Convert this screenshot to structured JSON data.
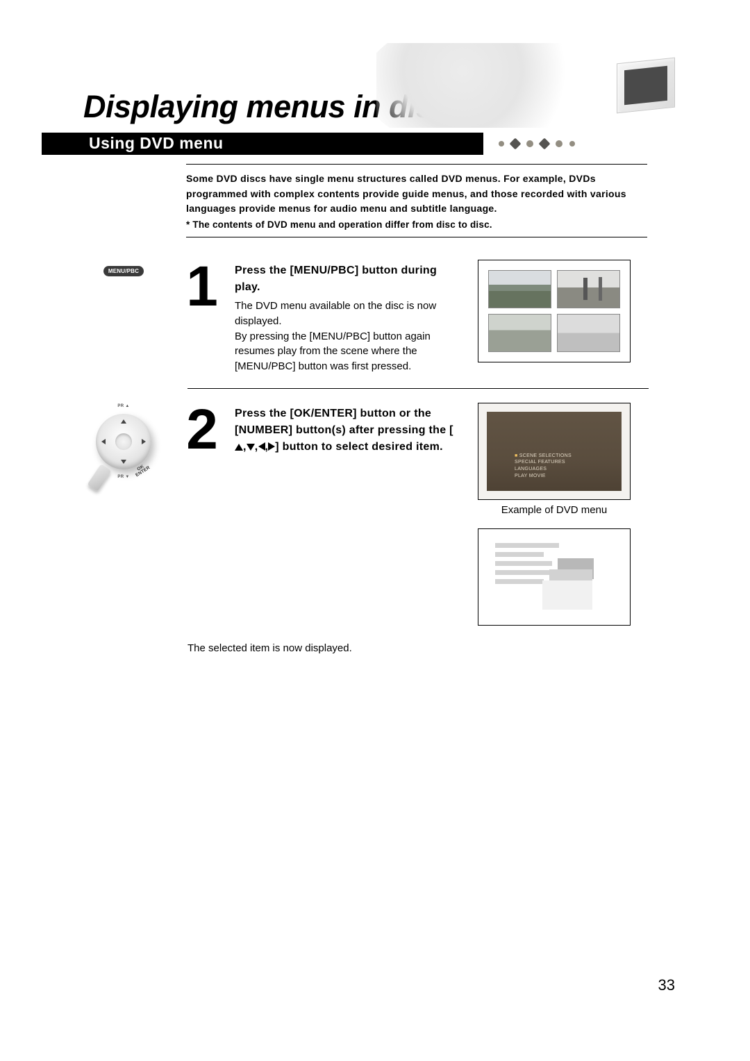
{
  "page": {
    "title": "Displaying menus in disc",
    "section_title": "Using DVD menu",
    "intro": "Some DVD discs have single menu structures called DVD menus. For example, DVDs programmed with  complex contents provide guide menus, and those recorded with various languages provide menus for audio menu and subtitle language.",
    "intro_note": "* The contents of DVD menu and operation differ from disc to disc.",
    "page_number": "33"
  },
  "icons": {
    "menu_pbc_label": "MENU/PBC",
    "pad_top": "PR ▲",
    "pad_bottom": "PR ▼",
    "pad_ok": "OK",
    "pad_enter": "ENTER"
  },
  "steps": {
    "s1": {
      "number": "1",
      "heading": "Press the [MENU/PBC] button during play.",
      "desc": "The DVD menu available on the disc is now displayed.\nBy pressing the [MENU/PBC] button again resumes play from the scene where the [MENU/PBC] button was first pressed."
    },
    "s2": {
      "number": "2",
      "heading_pre": "Press the [OK/ENTER] button or the [NUMBER] button(s) after pressing the [",
      "heading_post": "] button to select desired item.",
      "caption": "Example of DVD menu"
    }
  },
  "menu_example": {
    "line1": "SCENE SELECTIONS",
    "line2": "SPECIAL FEATURES",
    "line3": "LANGUAGES",
    "line4": "PLAY MOVIE"
  },
  "selected_text": "The selected item is now displayed."
}
